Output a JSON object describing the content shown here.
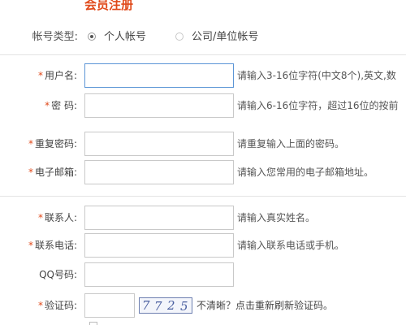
{
  "form": {
    "title": "会员注册",
    "account_type": {
      "label": "帐号类型:",
      "options": [
        "个人帐号",
        "公司/单位帐号"
      ],
      "selected": "个人帐号"
    },
    "fields": [
      {
        "label": "用户名:",
        "required": "*",
        "hint": "请输入3-16位字符(中文8个),英文,数"
      },
      {
        "label": "密 码:",
        "required": "*",
        "hint": "请输入6-16位字符，超过16位的按前"
      },
      {
        "label": "重复密码:",
        "required": "*",
        "hint": "请重复输入上面的密码。"
      },
      {
        "label": "电子邮箱:",
        "required": "*",
        "hint": "请输入您常用的电子邮箱地址。"
      },
      {
        "label": "联系人:",
        "required": "*",
        "hint": "请输入真实姓名。"
      },
      {
        "label": "联系电话:",
        "required": "*",
        "hint": "请输入联系电话或手机。"
      },
      {
        "label": "QQ号码:",
        "required": "",
        "hint": ""
      }
    ],
    "captcha": {
      "label": "验证码:",
      "required": "*",
      "code": [
        "7",
        "7",
        "2",
        "5"
      ],
      "hint": "不清晰？点击重新刷新验证码。"
    }
  }
}
